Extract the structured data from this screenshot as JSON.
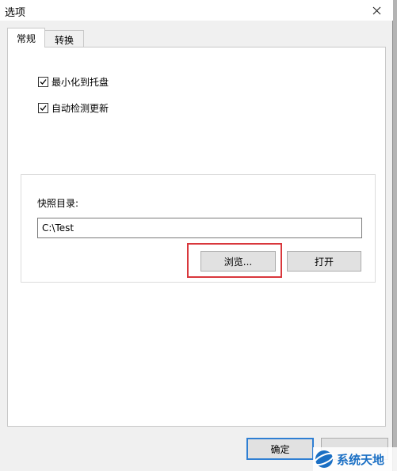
{
  "window": {
    "title": "选项"
  },
  "tabs": [
    {
      "label": "常规",
      "active": true
    },
    {
      "label": "转换",
      "active": false
    }
  ],
  "general": {
    "checkboxes": [
      {
        "label": "最小化到托盘",
        "checked": true
      },
      {
        "label": "自动检测更新",
        "checked": true
      }
    ],
    "snapshot": {
      "label": "快照目录:",
      "path": "C:\\Test",
      "browse_label": "浏览...",
      "open_label": "打开"
    }
  },
  "footer": {
    "ok_label": "确定"
  },
  "watermark": {
    "text": "系统天地"
  },
  "colors": {
    "highlight": "#d9373c",
    "default_button_border": "#2f7fd3"
  }
}
